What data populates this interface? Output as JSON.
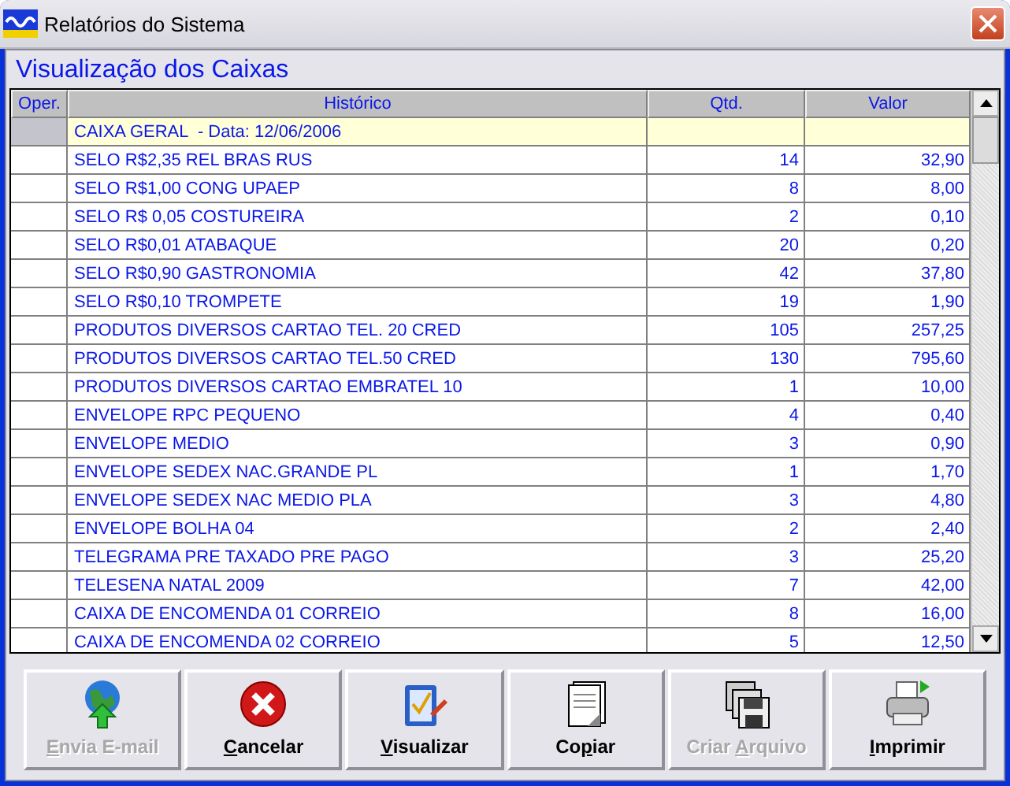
{
  "window": {
    "title": "Relatórios do Sistema"
  },
  "panel": {
    "title": "Visualização dos Caixas"
  },
  "table": {
    "columns": [
      "Oper.",
      "Histórico",
      "Qtd.",
      "Valor"
    ],
    "rows": [
      {
        "oper": "",
        "historico": "CAIXA GERAL  - Data: 12/06/2006",
        "qtd": "",
        "valor": "",
        "highlighted": true
      },
      {
        "oper": "",
        "historico": "SELO R$2,35 REL BRAS RUS",
        "qtd": "14",
        "valor": "32,90",
        "highlighted": false
      },
      {
        "oper": "",
        "historico": "SELO R$1,00 CONG UPAEP",
        "qtd": "8",
        "valor": "8,00",
        "highlighted": false
      },
      {
        "oper": "",
        "historico": "SELO R$ 0,05 COSTUREIRA",
        "qtd": "2",
        "valor": "0,10",
        "highlighted": false
      },
      {
        "oper": "",
        "historico": "SELO R$0,01 ATABAQUE",
        "qtd": "20",
        "valor": "0,20",
        "highlighted": false
      },
      {
        "oper": "",
        "historico": "SELO R$0,90 GASTRONOMIA",
        "qtd": "42",
        "valor": "37,80",
        "highlighted": false
      },
      {
        "oper": "",
        "historico": "SELO R$0,10 TROMPETE",
        "qtd": "19",
        "valor": "1,90",
        "highlighted": false
      },
      {
        "oper": "",
        "historico": "PRODUTOS DIVERSOS CARTAO TEL. 20 CRED",
        "qtd": "105",
        "valor": "257,25",
        "highlighted": false
      },
      {
        "oper": "",
        "historico": "PRODUTOS DIVERSOS CARTAO TEL.50 CRED",
        "qtd": "130",
        "valor": "795,60",
        "highlighted": false
      },
      {
        "oper": "",
        "historico": "PRODUTOS DIVERSOS CARTAO EMBRATEL 10",
        "qtd": "1",
        "valor": "10,00",
        "highlighted": false
      },
      {
        "oper": "",
        "historico": "ENVELOPE RPC PEQUENO",
        "qtd": "4",
        "valor": "0,40",
        "highlighted": false
      },
      {
        "oper": "",
        "historico": "ENVELOPE MEDIO",
        "qtd": "3",
        "valor": "0,90",
        "highlighted": false
      },
      {
        "oper": "",
        "historico": "ENVELOPE SEDEX NAC.GRANDE PL",
        "qtd": "1",
        "valor": "1,70",
        "highlighted": false
      },
      {
        "oper": "",
        "historico": "ENVELOPE SEDEX NAC MEDIO PLA",
        "qtd": "3",
        "valor": "4,80",
        "highlighted": false
      },
      {
        "oper": "",
        "historico": "ENVELOPE BOLHA 04",
        "qtd": "2",
        "valor": "2,40",
        "highlighted": false
      },
      {
        "oper": "",
        "historico": "TELEGRAMA PRE TAXADO PRE PAGO",
        "qtd": "3",
        "valor": "25,20",
        "highlighted": false
      },
      {
        "oper": "",
        "historico": "TELESENA NATAL 2009",
        "qtd": "7",
        "valor": "42,00",
        "highlighted": false
      },
      {
        "oper": "",
        "historico": "CAIXA DE ENCOMENDA 01 CORREIO",
        "qtd": "8",
        "valor": "16,00",
        "highlighted": false
      },
      {
        "oper": "",
        "historico": "CAIXA DE ENCOMENDA 02 CORREIO",
        "qtd": "5",
        "valor": "12,50",
        "highlighted": false
      }
    ]
  },
  "buttons": [
    {
      "kind": "email",
      "key": "E",
      "post": "nvia E-mail",
      "disabled": true
    },
    {
      "kind": "cancel",
      "key": "C",
      "post": "ancelar",
      "disabled": false
    },
    {
      "kind": "view",
      "key": "V",
      "post": "isualizar",
      "disabled": false
    },
    {
      "kind": "copy",
      "pre": "Co",
      "key": "p",
      "post": "iar",
      "disabled": false
    },
    {
      "kind": "file",
      "pre": "Criar ",
      "key": "A",
      "post": "rquivo",
      "disabled": true
    },
    {
      "kind": "print",
      "key": "I",
      "post": "mprimir",
      "disabled": false
    }
  ]
}
